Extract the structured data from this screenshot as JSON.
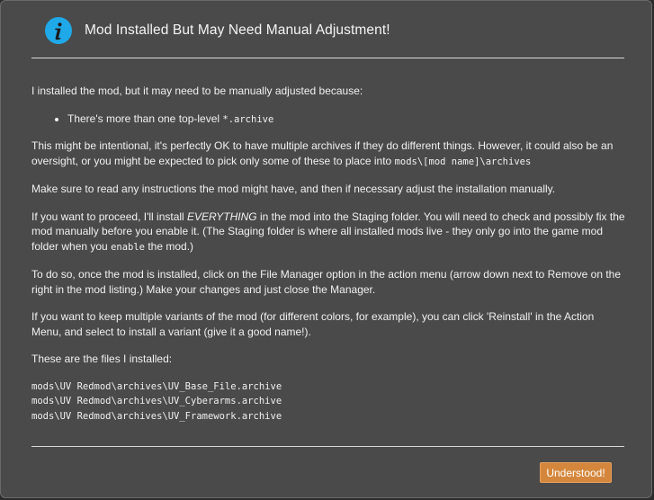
{
  "dialog": {
    "title": "Mod Installed But May Need Manual Adjustment!",
    "icon": "info-icon",
    "accent_color": "#20a9e8",
    "button_color": "#d4873c",
    "intro": "I installed the mod, but it may need to be manually adjusted because:",
    "reason_text": "There's more than one top-level ",
    "reason_code": "*.archive",
    "p1_text": "This might be intentional, it's perfectly OK to have multiple archives if they do different things. However, it could also be an oversight, or you might be expected to pick only some of these to place into ",
    "p1_code": "mods\\[mod name]\\archives",
    "p2": "Make sure to read any instructions the mod might have, and then if necessary adjust the installation manually.",
    "p3_a": "If you want to proceed, I'll install ",
    "p3_em": "EVERYTHING",
    "p3_b": " in the mod into the Staging folder. You will need to check and possibly fix the mod manually before you enable it. (The Staging folder is where all installed mods live - they only go into the game mod folder when you ",
    "p3_code": "enable",
    "p3_c": " the mod.)",
    "p4": "To do so, once the mod is installed, click on the File Manager option in the action menu (arrow down next to Remove on the right in the mod listing.) Make your changes and just close the Manager.",
    "p5": "If you want to keep multiple variants of the mod (for different colors, for example), you can click 'Reinstall' in the Action Menu, and select to install a variant (give it a good name!).",
    "files_heading": "These are the files I installed:",
    "files": [
      "mods\\UV Redmod\\archives\\UV_Base_File.archive",
      "mods\\UV Redmod\\archives\\UV_Cyberarms.archive",
      "mods\\UV Redmod\\archives\\UV_Framework.archive"
    ],
    "button_label": "Understood!"
  }
}
